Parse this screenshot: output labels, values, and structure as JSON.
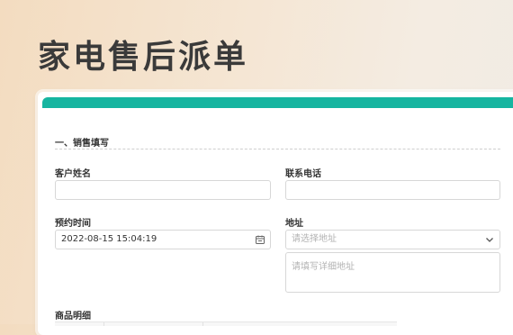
{
  "page": {
    "title": "家电售后派单"
  },
  "form": {
    "section_title": "一、销售填写",
    "customer_name": {
      "label": "客户姓名",
      "value": ""
    },
    "phone": {
      "label": "联系电话",
      "value": ""
    },
    "appointment": {
      "label": "预约时间",
      "value": "2022-08-15 15:04:19"
    },
    "address": {
      "label": "地址",
      "select_placeholder": "请选择地址",
      "detail_placeholder": "请填写详细地址"
    },
    "goods": {
      "label": "商品明细"
    }
  },
  "colors": {
    "accent": "#16b5a0"
  }
}
